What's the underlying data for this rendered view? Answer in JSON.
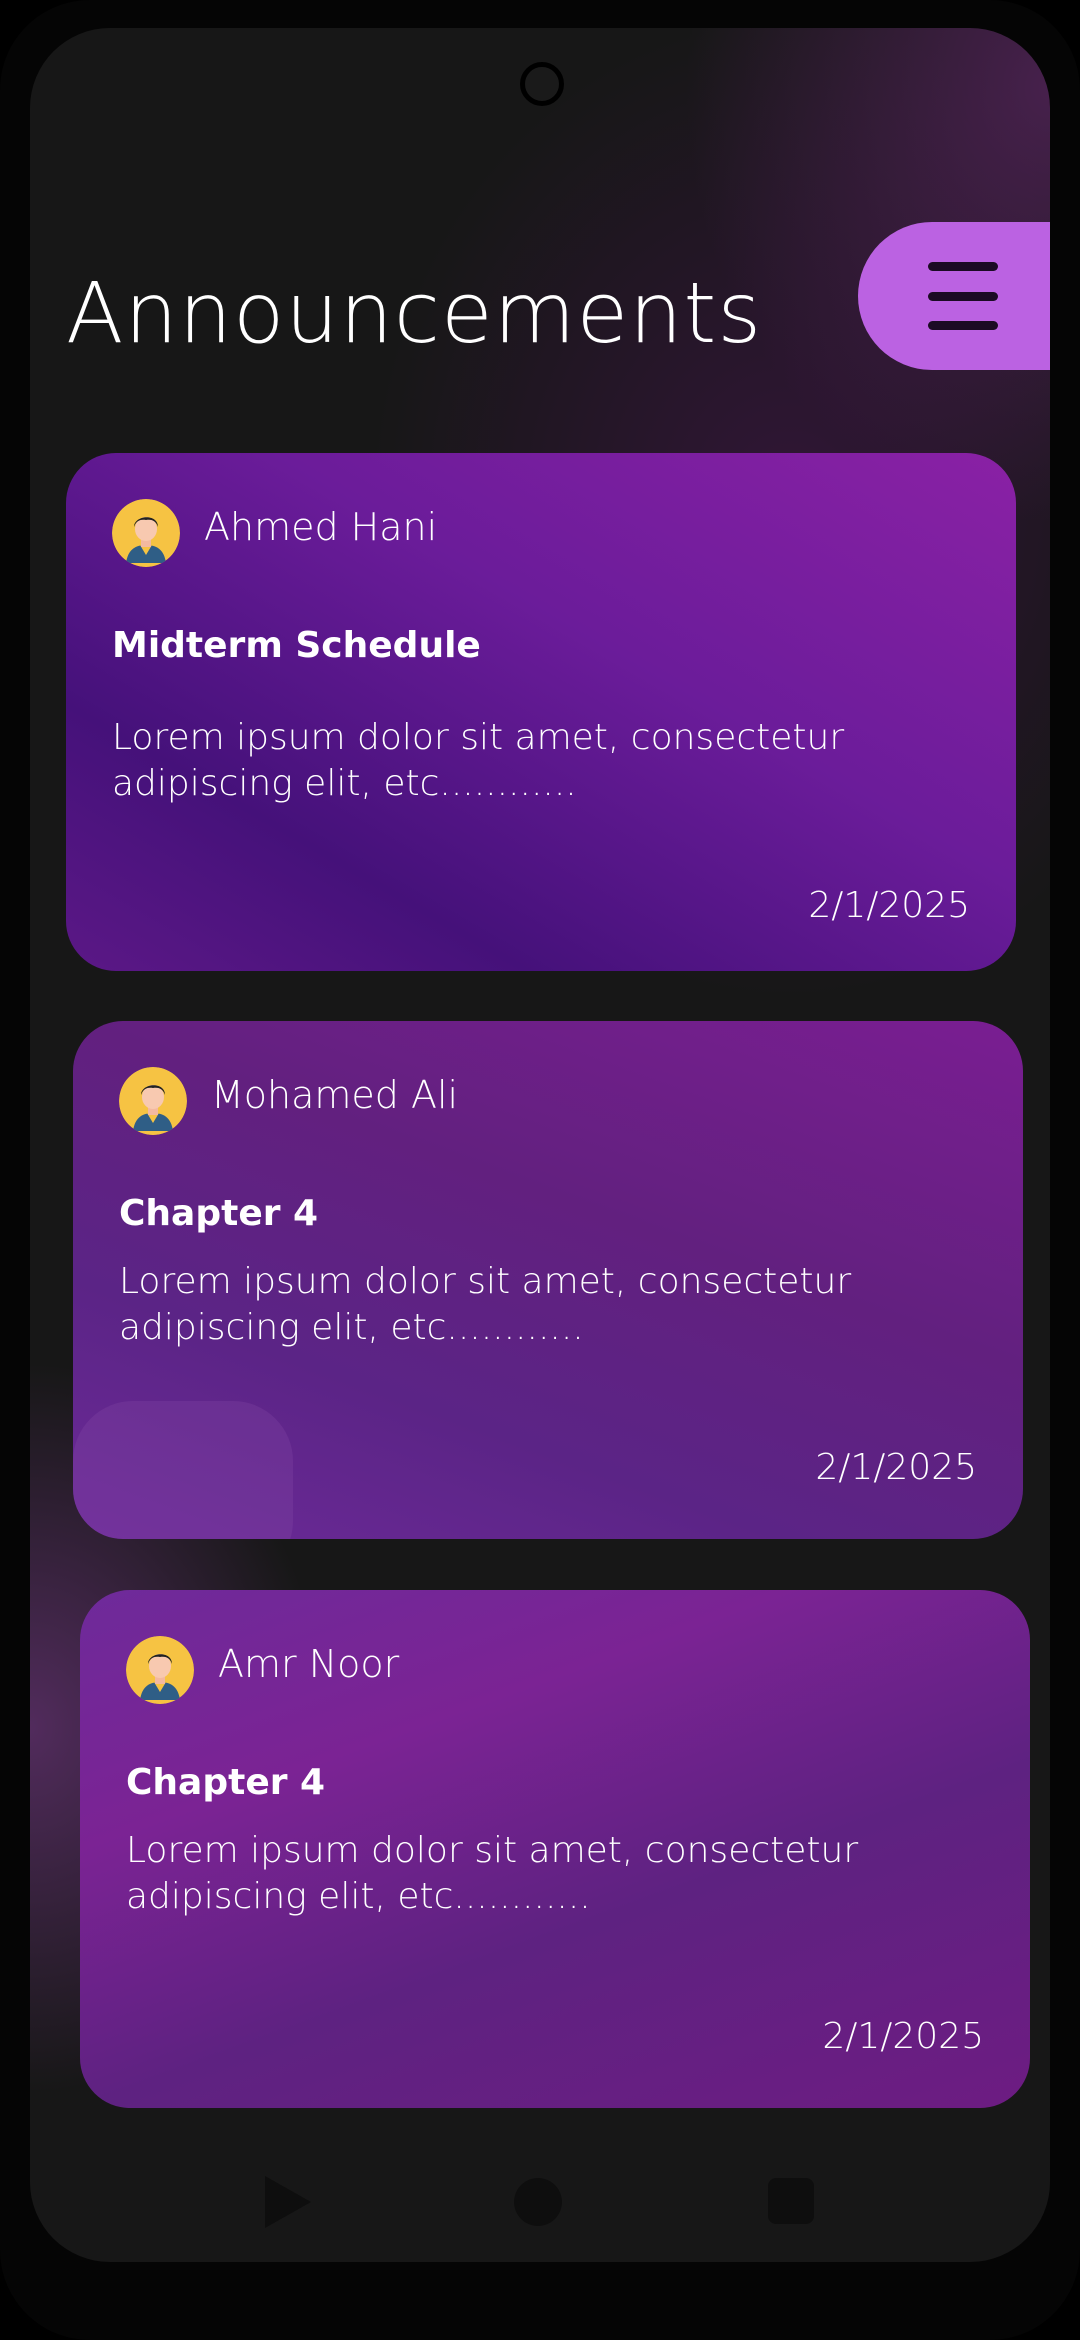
{
  "header": {
    "title": "Announcements",
    "menu_icon": "hamburger-menu-icon"
  },
  "announcements": [
    {
      "author": "Ahmed Hani",
      "subject": "Midterm Schedule",
      "body": "Lorem ipsum dolor sit amet, consectetur adipiscing elit, etc............",
      "date": "2/1/2025",
      "avatar_icon": "user-avatar-icon"
    },
    {
      "author": "Mohamed Ali",
      "subject": "Chapter 4",
      "body": "Lorem ipsum dolor sit amet, consectetur adipiscing elit, etc............",
      "date": "2/1/2025",
      "avatar_icon": "user-avatar-icon"
    },
    {
      "author": "Amr Noor",
      "subject": "Chapter 4",
      "body": "Lorem ipsum dolor sit amet, consectetur adipiscing elit, etc............",
      "date": "2/1/2025",
      "avatar_icon": "user-avatar-icon"
    }
  ],
  "navigation": {
    "back_icon": "back-triangle-icon",
    "home_icon": "home-circle-icon",
    "recents_icon": "recents-square-icon"
  },
  "colors": {
    "background": "#171717",
    "accent": "#bb62e2",
    "card_purple": "#6b1c9a",
    "text": "#ffffff"
  }
}
